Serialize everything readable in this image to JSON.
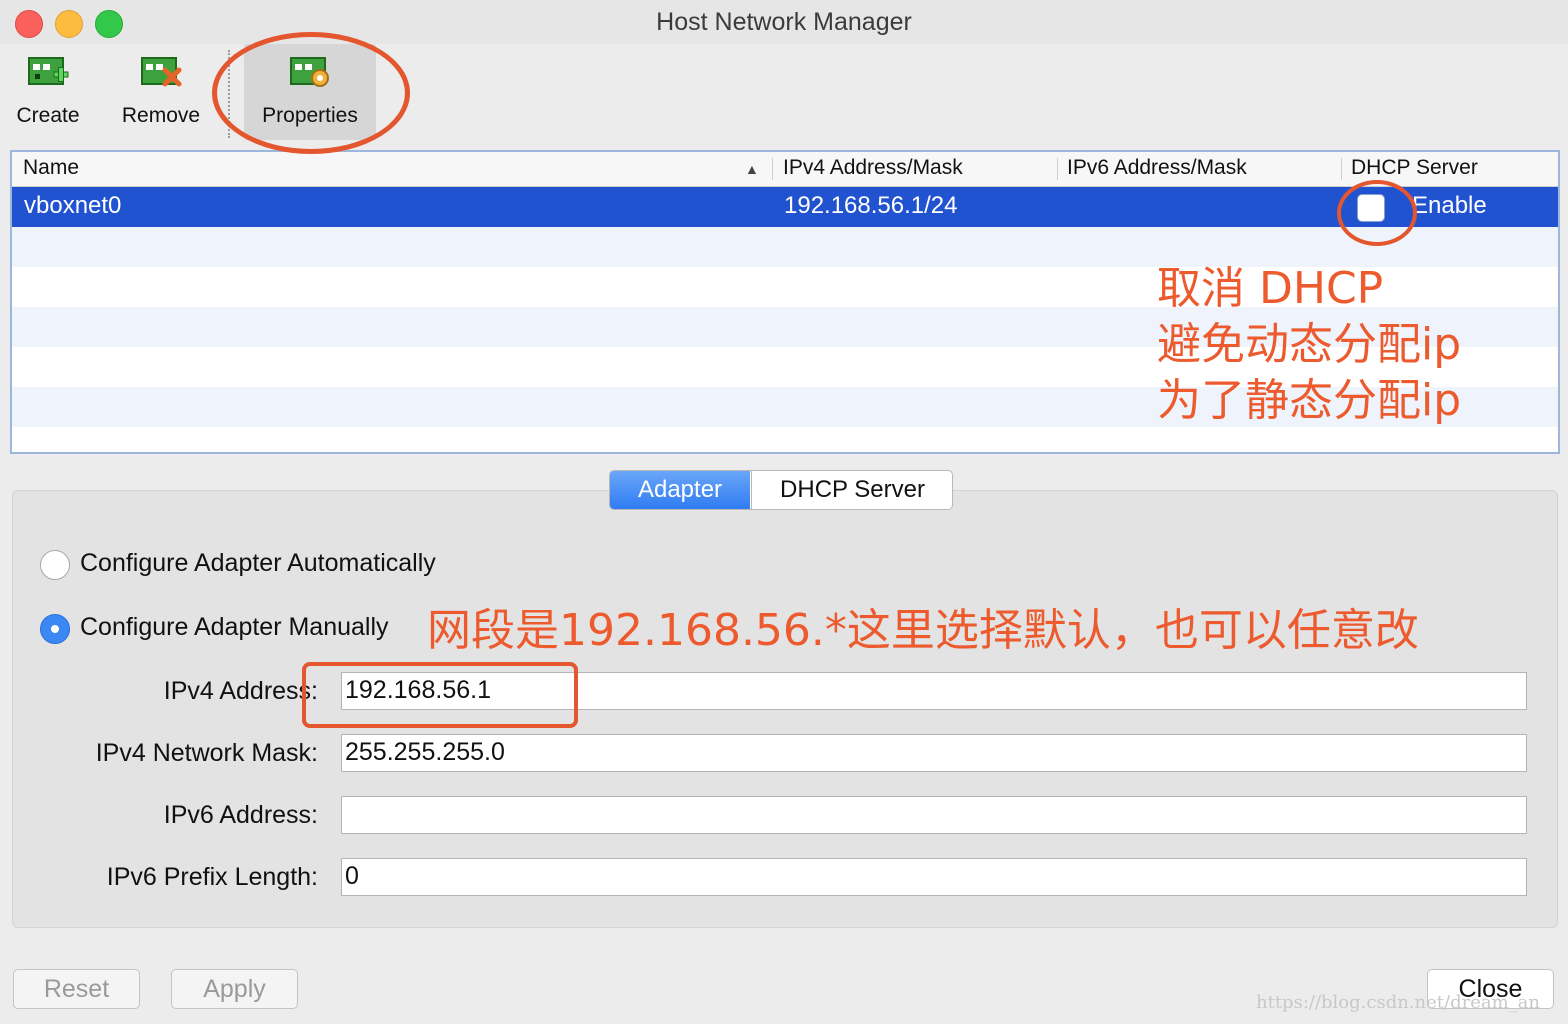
{
  "window": {
    "title": "Host Network Manager"
  },
  "toolbar": {
    "create": {
      "label": "Create",
      "icon": "network-create-icon"
    },
    "remove": {
      "label": "Remove",
      "icon": "network-remove-icon"
    },
    "properties": {
      "label": "Properties",
      "icon": "network-properties-icon"
    }
  },
  "table": {
    "columns": [
      "Name",
      "IPv4 Address/Mask",
      "IPv6 Address/Mask",
      "DHCP Server"
    ],
    "sort_indicator": "▲",
    "rows": [
      {
        "name": "vboxnet0",
        "ipv4": "192.168.56.1/24",
        "ipv6": "",
        "dhcp_enabled": false,
        "dhcp_label": "Enable"
      }
    ]
  },
  "tabs": {
    "active": "Adapter",
    "items": [
      "Adapter",
      "DHCP Server"
    ]
  },
  "adapter": {
    "mode_auto_label": "Configure Adapter Automatically",
    "mode_manual_label": "Configure Adapter Manually",
    "selected_mode": "manual",
    "fields": [
      {
        "label": "IPv4 Address:",
        "value": "192.168.56.1"
      },
      {
        "label": "IPv4 Network Mask:",
        "value": "255.255.255.0"
      },
      {
        "label": "IPv6 Address:",
        "value": ""
      },
      {
        "label": "IPv6 Prefix Length:",
        "value": "0"
      }
    ]
  },
  "buttons": {
    "reset": "Reset",
    "apply": "Apply",
    "close": "Close"
  },
  "annotations": {
    "dhcp_note": "取消 DHCP\n避免动态分配ip\n为了静态分配ip",
    "subnet_note": "网段是192.168.56.*这里选择默认，也可以任意改",
    "color": "#ec5a2e"
  },
  "watermark": "https://blog.csdn.net/dream_an",
  "colors": {
    "selection": "#2153d0",
    "accent_tab": "#2f7cf2",
    "annotation": "#e4562e"
  }
}
